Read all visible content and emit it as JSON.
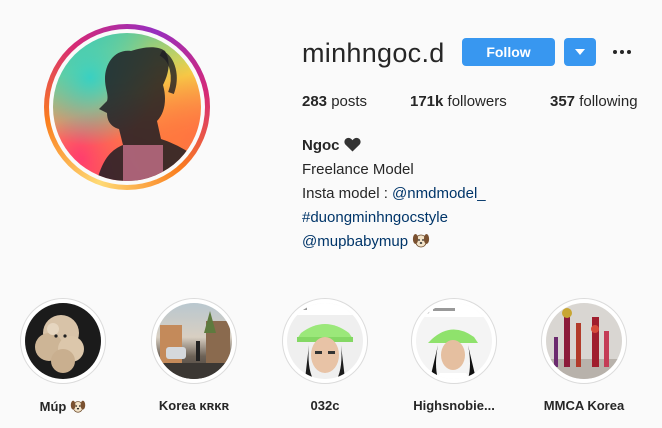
{
  "profile": {
    "username": "minhngoc.d",
    "follow_label": "Follow",
    "stats": {
      "posts_count": "283",
      "posts_label": " posts",
      "followers_count": "171k",
      "followers_label": " followers",
      "following_count": "357",
      "following_label": " following"
    },
    "bio": {
      "name": "Ngoc",
      "line1": "Freelance Model",
      "line2_prefix": "Insta model : ",
      "line2_link": "@nmdmodel_",
      "line3": "#duongminhngocstyle",
      "line4": "@mupbabymup"
    }
  },
  "highlights": [
    {
      "label": "Múp"
    },
    {
      "label": "Korea ᴋʀᴋʀ"
    },
    {
      "label": "032c"
    },
    {
      "label": "Highsnobie..."
    },
    {
      "label": "MMCA Korea"
    }
  ],
  "icons": {
    "heart": "black-heart-icon",
    "dog": "dog-emoji-icon",
    "dropdown": "chevron-down-icon",
    "more": "more-options-icon"
  },
  "colors": {
    "accent": "#3897f0",
    "link": "#003569",
    "text": "#262626",
    "background": "#fafafa"
  }
}
